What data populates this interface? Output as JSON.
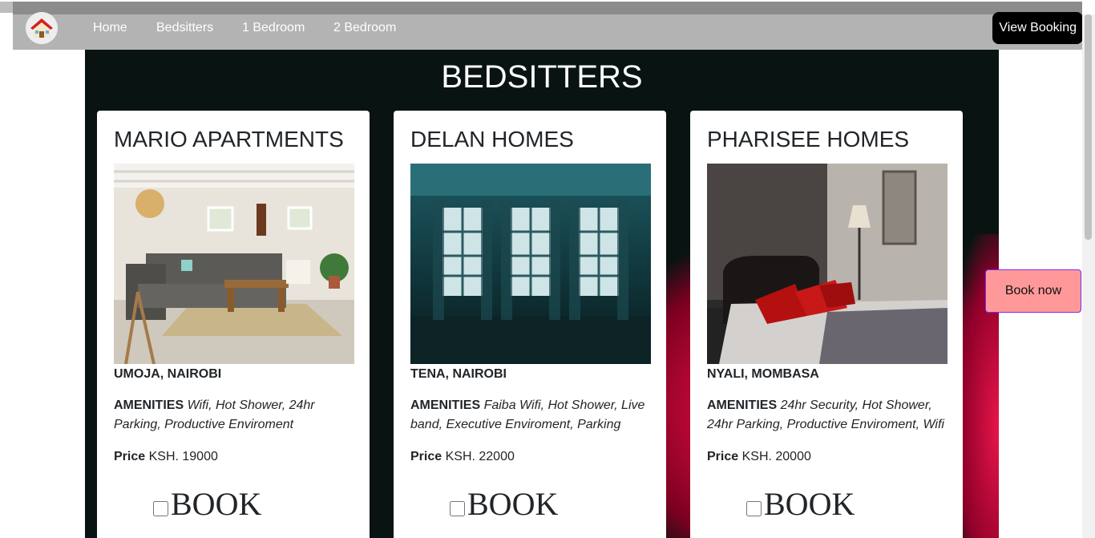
{
  "nav": {
    "links": [
      "Home",
      "Bedsitters",
      "1 Bedroom",
      "2 Bedroom"
    ],
    "view_booking": "View Booking"
  },
  "section": {
    "title": "BEDSITTERS"
  },
  "cards": [
    {
      "title": "MARIO APARTMENTS",
      "location": "UMOJA, NAIROBI",
      "amenities_label": "AMENITIES",
      "amenities": "Wifi, Hot Shower, 24hr Parking, Productive Enviroment",
      "price_label": "Price",
      "price": "KSH. 19000",
      "book_label": "BOOK"
    },
    {
      "title": "DELAN HOMES",
      "location": "TENA, NAIROBI",
      "amenities_label": "AMENITIES",
      "amenities": "Faiba Wifi, Hot Shower, Live band, Executive Enviroment, Parking",
      "price_label": "Price",
      "price": "KSH. 22000",
      "book_label": "BOOK"
    },
    {
      "title": "PHARISEE HOMES",
      "location": "NYALI, MOMBASA",
      "amenities_label": "AMENITIES",
      "amenities": "24hr Security, Hot Shower, 24hr Parking, Productive Enviroment, Wifi",
      "price_label": "Price",
      "price": "KSH. 20000",
      "book_label": "BOOK"
    }
  ],
  "book_now": "Book now",
  "colors": {
    "navbar": "#b3b3b3",
    "section_bg": "#091312",
    "book_now_bg": "#ff9999",
    "view_booking_bg": "#000000"
  }
}
